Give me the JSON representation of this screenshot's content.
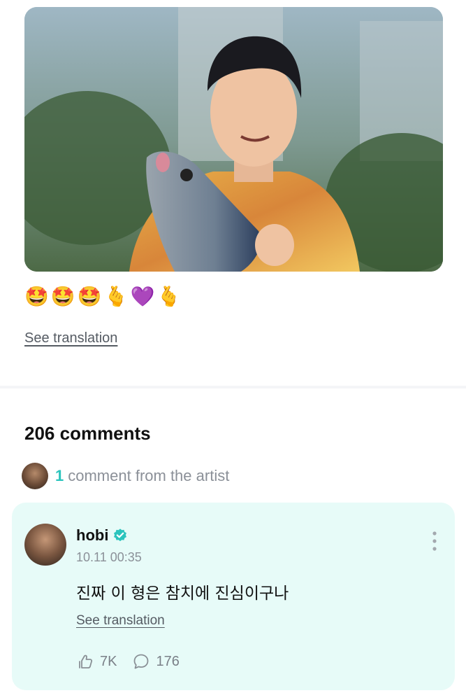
{
  "post": {
    "image_alt": "photo of a person holding a tuna plush",
    "emojis": "🤩🤩🤩🫰💜🫰",
    "see_translation": "See translation"
  },
  "comments": {
    "count_label": "206 comments",
    "artist_count": "1",
    "artist_label": "comment from the artist"
  },
  "artist_comment": {
    "author": "hobi",
    "timestamp": "10.11 00:35",
    "text": "진짜 이 형은 참치에 진심이구나",
    "see_translation": "See translation",
    "likes": "7K",
    "replies": "176"
  },
  "colors": {
    "accent": "#2bc4bd",
    "card_bg": "#e7fbf8",
    "muted_text": "#8b9098"
  }
}
